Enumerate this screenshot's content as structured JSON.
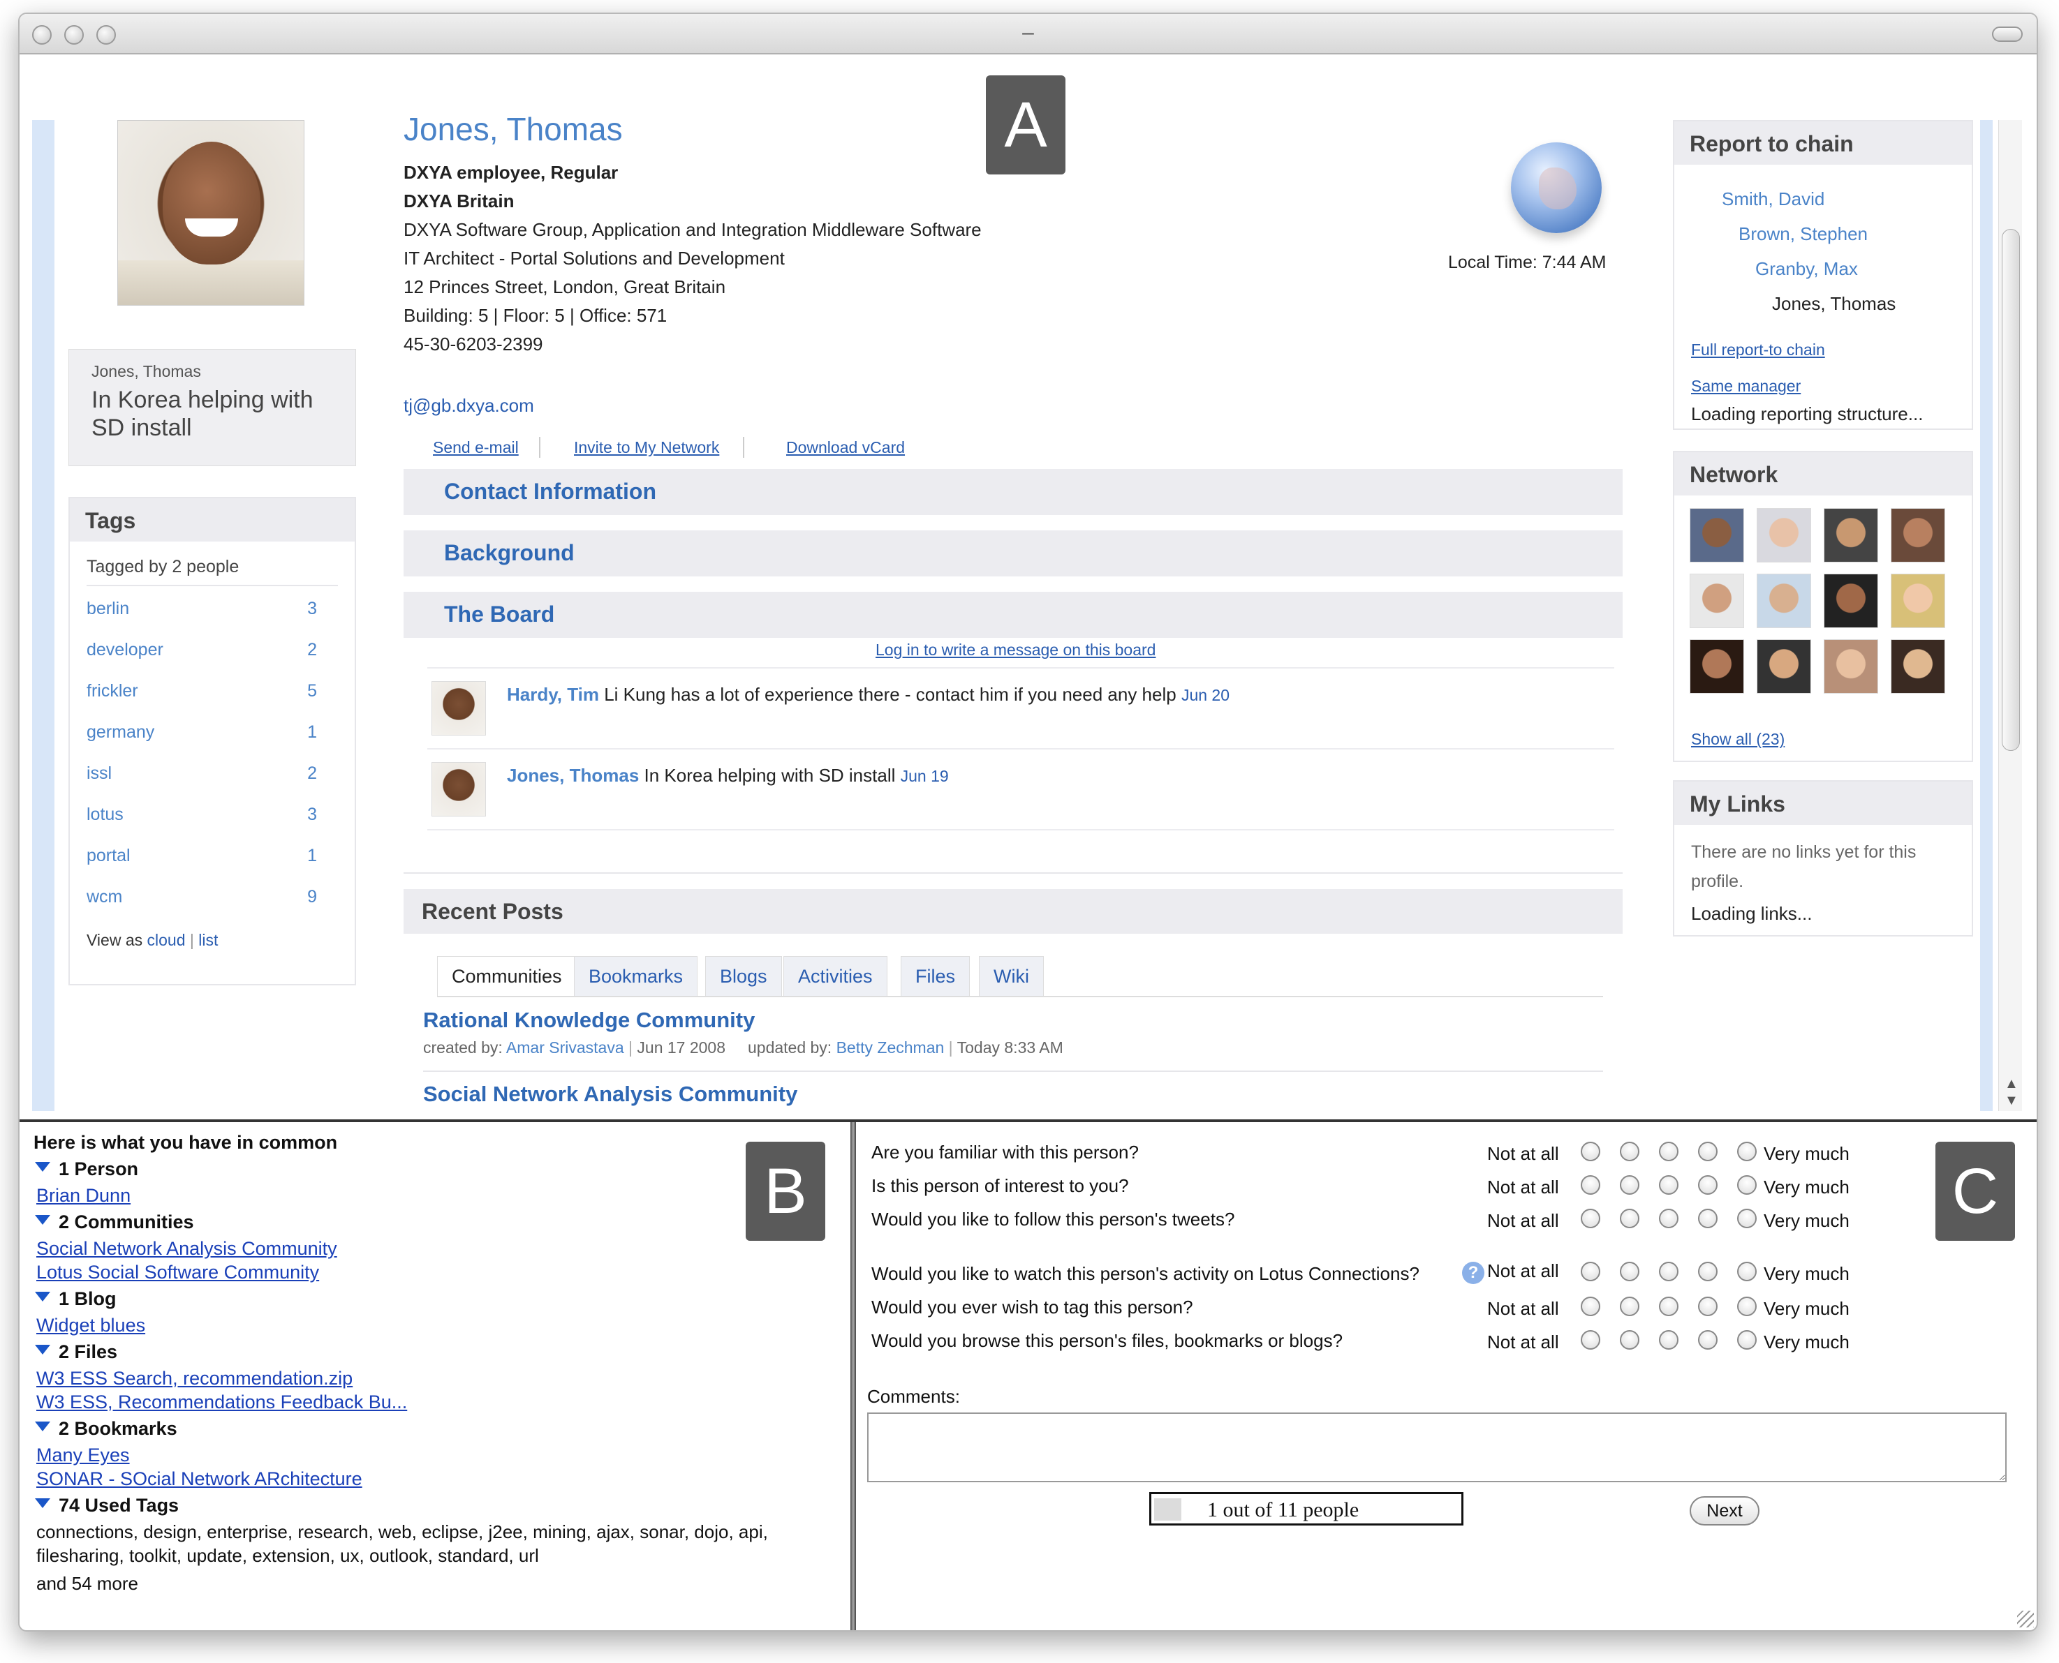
{
  "window": {
    "title": "–"
  },
  "labels": {
    "a": "A",
    "b": "B",
    "c": "C"
  },
  "profile": {
    "name": "Jones, Thomas",
    "lines": [
      "DXYA employee, Regular",
      "DXYA Britain",
      "DXYA Software Group, Application and Integration Middleware Software",
      "IT Architect - Portal Solutions and Development",
      "12 Princes Street, London, Great Britain",
      "Building: 5  | Floor: 5  | Office: 571",
      "45-30-6203-2399"
    ],
    "email": "tj@gb.dxya.com",
    "actions": [
      "Send e-mail",
      "Invite to My Network",
      "Download vCard"
    ],
    "local_time": "Local Time: 7:44 AM"
  },
  "status": {
    "name": "Jones, Thomas",
    "text": "In Korea helping with SD install"
  },
  "tags": {
    "title": "Tags",
    "tagged_by": "Tagged by 2 people",
    "items": [
      {
        "name": "berlin",
        "count": "3"
      },
      {
        "name": "developer",
        "count": "2"
      },
      {
        "name": "frickler",
        "count": "5"
      },
      {
        "name": "germany",
        "count": "1"
      },
      {
        "name": "issl",
        "count": "2"
      },
      {
        "name": "lotus",
        "count": "3"
      },
      {
        "name": "portal",
        "count": "1"
      },
      {
        "name": "wcm",
        "count": "9"
      }
    ],
    "view_as": "View as",
    "view_cloud": "cloud",
    "view_list": "list"
  },
  "sections": {
    "contact": "Contact Information",
    "background": "Background",
    "board": "The Board"
  },
  "board": {
    "login_link": "Log in to write a message on this board",
    "entries": [
      {
        "author": "Hardy, Tim",
        "message": "Li Kung has a lot of experience there - contact him if you need any help",
        "date": "Jun 20"
      },
      {
        "author": "Jones, Thomas",
        "message": "In Korea helping with SD install",
        "date": "Jun 19"
      }
    ]
  },
  "recent_posts": {
    "title": "Recent Posts",
    "tabs": [
      "Communities",
      "Bookmarks",
      "Blogs",
      "Activities",
      "Files",
      "Wiki"
    ],
    "active_tab": "Communities",
    "posts": [
      {
        "title": "Rational Knowledge Community",
        "created_label": "created by:",
        "creator": "Amar Srivastava",
        "created_date": "Jun 17 2008",
        "updated_label": "updated by:",
        "updater": "Betty Zechman",
        "updated_date": "Today 8:33 AM"
      },
      {
        "title": "Social Network Analysis Community"
      }
    ]
  },
  "report_chain": {
    "title": "Report to chain",
    "chain": [
      "Smith, David",
      "Brown, Stephen",
      "Granby, Max",
      "Jones, Thomas"
    ],
    "full_link": "Full report-to chain",
    "same_manager": "Same manager",
    "loading": "Loading reporting structure..."
  },
  "network": {
    "title": "Network",
    "show_all": "Show all (23)"
  },
  "my_links": {
    "title": "My Links",
    "empty": "There are no links yet for this profile.",
    "loading": "Loading links..."
  },
  "common": {
    "title": "Here is what you have in common",
    "groups": [
      {
        "heading": "1 Person",
        "items": [
          "Brian Dunn"
        ]
      },
      {
        "heading": "2 Communities",
        "items": [
          "Social Network Analysis Community",
          "Lotus Social Software Community"
        ]
      },
      {
        "heading": "1 Blog",
        "items": [
          "Widget blues"
        ]
      },
      {
        "heading": "2 Files",
        "items": [
          "W3 ESS Search, recommendation.zip",
          "W3 ESS, Recommendations Feedback Bu..."
        ]
      },
      {
        "heading": "2 Bookmarks",
        "items": [
          "Many Eyes",
          "SONAR - SOcial Network ARchitecture"
        ]
      }
    ],
    "tags_heading": "74 Used Tags",
    "tags_text_1": "connections, design, enterprise, research, web, eclipse, j2ee, mining, ajax, sonar, dojo, api,",
    "tags_text_2": "filesharing, toolkit, update, extension, ux, outlook, standard, url",
    "more": "and 54 more"
  },
  "survey": {
    "questions": [
      "Are you familiar with this person?",
      "Is this person of interest to you?",
      "Would you like to follow this person's tweets?",
      "Would you like to watch this person's activity on Lotus Connections?",
      "Would you ever wish to tag this person?",
      "Would you browse this person's files, bookmarks or blogs?"
    ],
    "scale_low": "Not at all",
    "scale_high": "Very much",
    "help": "?",
    "comments_label": "Comments:",
    "progress_text": "1 out of 11 people",
    "progress_fraction": 0.09,
    "next_label": "Next"
  }
}
